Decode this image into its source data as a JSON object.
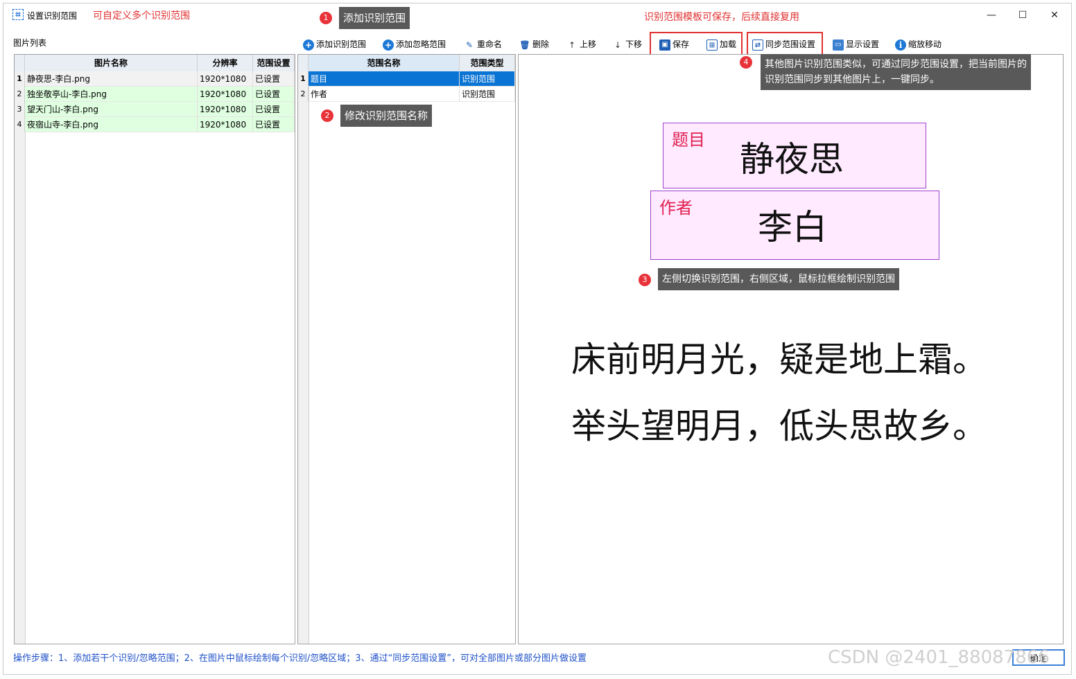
{
  "window": {
    "title": "设置识别范围",
    "note_left": "可自定义多个识别范围",
    "note_right": "识别范围模板可保存，后续直接复用",
    "minimize_glyph": "—",
    "maximize_glyph": "☐",
    "close_glyph": "✕"
  },
  "left_panel": {
    "label": "图片列表",
    "columns": [
      "图片名称",
      "分辨率",
      "范围设置"
    ],
    "rows": [
      {
        "num": "1",
        "name": "静夜思-李白.png",
        "resolution": "1920*1080",
        "status": "已设置"
      },
      {
        "num": "2",
        "name": "独坐敬亭山-李白.png",
        "resolution": "1920*1080",
        "status": "已设置"
      },
      {
        "num": "3",
        "name": "望天门山-李白.png",
        "resolution": "1920*1080",
        "status": "已设置"
      },
      {
        "num": "4",
        "name": "夜宿山寺-李白.png",
        "resolution": "1920*1080",
        "status": "已设置"
      }
    ]
  },
  "toolbar": {
    "add_region": "添加识别范围",
    "add_ignore": "添加忽略范围",
    "rename": "重命名",
    "delete": "删除",
    "move_up": "上移",
    "move_down": "下移",
    "save": "保存",
    "load": "加载",
    "sync": "同步范围设置",
    "display": "显示设置",
    "zoom": "缩放移动"
  },
  "middle_panel": {
    "columns": [
      "范围名称",
      "范围类型"
    ],
    "rows": [
      {
        "num": "1",
        "name": "题目",
        "type": "识别范围"
      },
      {
        "num": "2",
        "name": "作者",
        "type": "识别范围"
      }
    ]
  },
  "callouts": {
    "c1": {
      "num": "1",
      "text": "添加识别范围"
    },
    "c2": {
      "num": "2",
      "text": "修改识别范围名称"
    },
    "c3": {
      "num": "3",
      "text": "左侧切换识别范围，右侧区域，鼠标拉框绘制识别范围"
    },
    "c4": {
      "num": "4",
      "line1": "其他图片识别范围类似，可通过同步范围设置，把当前图片的",
      "line2": "识别范围同步到其他图片上，一键同步。"
    }
  },
  "canvas": {
    "roi_title_label": "题目",
    "roi_title_text": "静夜思",
    "roi_author_label": "作者",
    "roi_author_text": "李白",
    "poem_line1": "床前明月光，疑是地上霜。",
    "poem_line2": "举头望明月，低头思故乡。"
  },
  "footer": {
    "instructions": "操作步骤：1、添加若干个识别/忽略范围；2、在图片中鼠标绘制每个识别/忽略区域；3、通过“同步范围设置”，可对全部图片或部分图片做设置",
    "ok_button": "确定",
    "watermark": "CSDN @2401_88087866"
  },
  "colors": {
    "accent": "#1e78d6",
    "annotation_red": "#e03030",
    "selected_row": "#0a74d4",
    "set_row_green": "#dfffe0",
    "callout_bg": "#595959",
    "roi_border": "#a040d0"
  }
}
